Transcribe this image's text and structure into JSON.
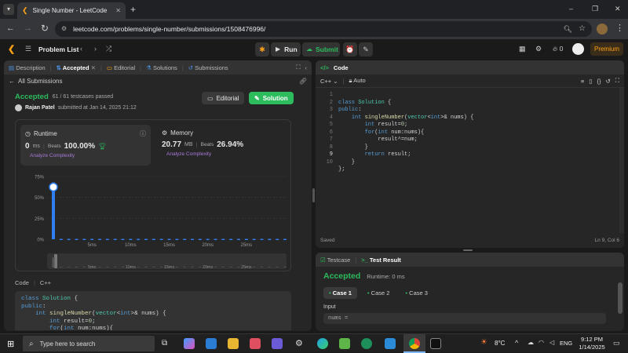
{
  "browser": {
    "tab_title": "Single Number - LeetCode",
    "url": "leetcode.com/problems/single-number/submissions/1508476996/",
    "new_tab": "+",
    "minimize": "–",
    "maximize": "❐",
    "close": "✕"
  },
  "topbar": {
    "problem_list": "Problem List",
    "run": "Run",
    "submit": "Submit",
    "streak": "0",
    "premium": "Premium"
  },
  "left_tabs": [
    "Description",
    "Accepted",
    "Editorial",
    "Solutions",
    "Submissions"
  ],
  "all_submissions": "All Submissions",
  "result": {
    "status": "Accepted",
    "tests": "61 / 61 testcases passed",
    "user": "Rajan Patel",
    "submitted": "submitted at Jan 14, 2025 21:12",
    "editorial_btn": "Editorial",
    "solution_btn": "Solution"
  },
  "runtime": {
    "label": "Runtime",
    "value": "0",
    "unit": "ms",
    "beats_label": "Beats",
    "beats": "100.00%",
    "analyze": "Analyze Complexity"
  },
  "memory": {
    "label": "Memory",
    "value": "20.77",
    "unit": "MB",
    "beats_label": "Beats",
    "beats": "26.94%",
    "analyze": "Analyze Complexity"
  },
  "chart_data": {
    "type": "bar",
    "y_ticks": [
      "75%",
      "50%",
      "25%",
      "0%"
    ],
    "x_ticks": [
      "5ms",
      "10ms",
      "15ms",
      "20ms",
      "25ms"
    ],
    "ylim": [
      0,
      75
    ],
    "values": [
      68,
      0.5,
      0.5,
      0.5,
      0.5,
      0.5,
      0.5,
      0.5,
      0.5,
      0.5,
      0.5,
      0.5,
      0.5,
      0.5,
      0.5,
      0.5,
      0.5,
      0.5,
      0.5,
      0.5,
      0.5,
      0.5,
      0.5,
      0.5,
      0.5,
      0.5,
      0.5,
      0.5,
      0.5,
      0.5,
      0.5
    ],
    "highlight_index": 0,
    "mini_ticks": [
      "5ms",
      "10ms",
      "15ms",
      "20ms",
      "25ms"
    ]
  },
  "code_section": {
    "label": "Code",
    "lang": "C++",
    "preview": [
      "class Solution {",
      "public:",
      "    int singleNumber(vector<int>& nums) {",
      "        int result=0;",
      "        for(int num:nums){"
    ]
  },
  "editor": {
    "title": "Code",
    "lang": "C++",
    "auto": "Auto",
    "saved": "Saved",
    "cursor": "Ln 9, Col 6",
    "lines": [
      "1",
      "2",
      "3",
      "4",
      "5",
      "6",
      "7",
      "8",
      "9",
      "10"
    ]
  },
  "testpanel": {
    "tab1": "Testcase",
    "tab2": "Test Result",
    "status": "Accepted",
    "runtime": "Runtime: 0 ms",
    "cases": [
      "Case 1",
      "Case 2",
      "Case 3"
    ],
    "input_label": "Input",
    "input_val": "nums ="
  },
  "taskbar": {
    "search": "Type here to search",
    "temp": "8°C",
    "lang": "ENG",
    "time": "9:12 PM",
    "date": "1/14/2025"
  }
}
